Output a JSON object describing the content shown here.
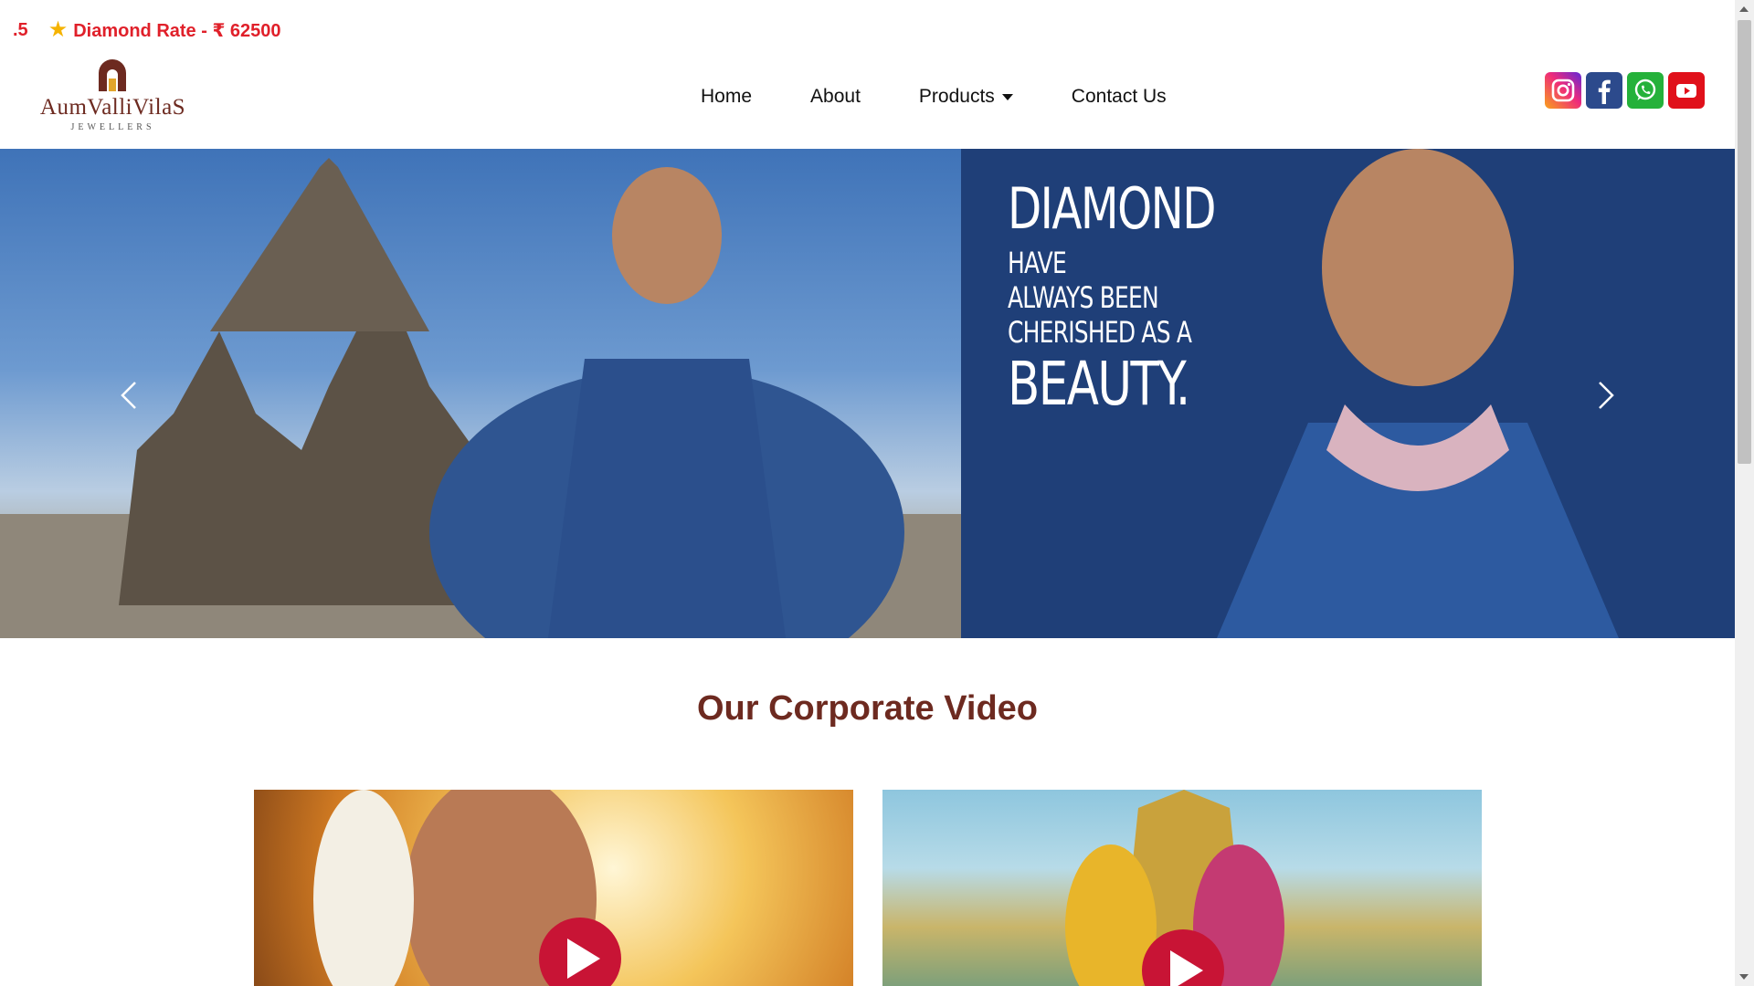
{
  "ticker": {
    "prev_fragment": ".5",
    "label": "Diamond Rate - ₹ 62500"
  },
  "logo": {
    "name": "AumValliVilaS",
    "subtitle": "JEWELLERS"
  },
  "nav": {
    "items": [
      "Home",
      "About",
      "Products",
      "Contact Us"
    ]
  },
  "social": [
    "instagram-icon",
    "facebook-icon",
    "whatsapp-icon",
    "youtube-icon"
  ],
  "hero": {
    "line1": "Diamond",
    "line2": "Have",
    "line3": "Always been",
    "line4": "cherished as a",
    "line5": "Beauty."
  },
  "section": {
    "title": "Our Corporate Video"
  },
  "colors": {
    "accent_red": "#e0202a",
    "brand_brown": "#6d2a20",
    "hero_blue": "#1f3f78",
    "play_red": "#c81435"
  }
}
